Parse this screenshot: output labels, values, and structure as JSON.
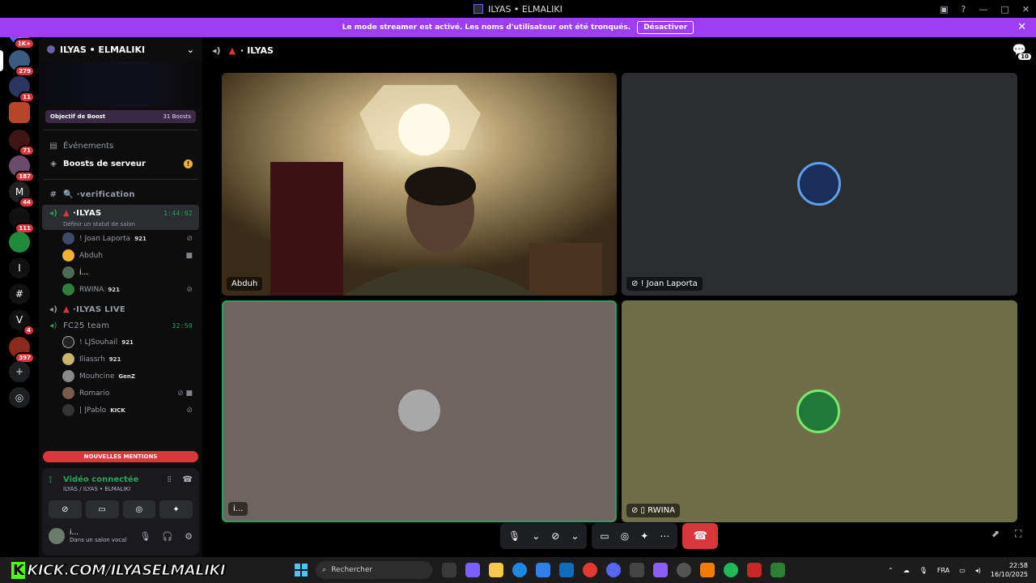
{
  "window": {
    "title": "ILYAS • ELMALIKI"
  },
  "banner": {
    "text": "Le mode streamer est activé. Les noms d'utilisateur ont été tronqués.",
    "button": "Désactiver"
  },
  "guilds": [
    {
      "badge": "1K+"
    },
    {
      "badge": "279"
    },
    {
      "badge": "11"
    },
    {
      "badge": ""
    },
    {
      "badge": "71"
    },
    {
      "badge": "187"
    },
    {
      "badge": "44"
    },
    {
      "badge": "111"
    },
    {
      "badge": ""
    },
    {
      "badge": ""
    },
    {
      "badge": ""
    },
    {
      "badge": "4"
    },
    {
      "badge": "397"
    }
  ],
  "sidebar": {
    "server_name": "ILYAS • ELMALIKI",
    "boost_goal": "Objectif de Boost",
    "boost_count": "31 Boosts",
    "events": "Événements",
    "server_boosts": "Boosts de serveur",
    "channel_verification": "verification",
    "active_channel": {
      "name": "ILYAS",
      "time": "1:44:02",
      "status": "Définir un statut de salon"
    },
    "active_users": [
      {
        "name": "! Joan Laporta",
        "tag": "921"
      },
      {
        "name": "Abduh",
        "tag": ""
      },
      {
        "name": "i...",
        "tag": ""
      },
      {
        "name": "RWINA",
        "tag": "921"
      }
    ],
    "channel_live": "ILYAS LIVE",
    "channel_fc25": {
      "name": "FC25 team",
      "time": "32:50"
    },
    "fc25_users": [
      {
        "name": "! LJSouhail",
        "tag": "921"
      },
      {
        "name": "Iliassrh",
        "tag": "921"
      },
      {
        "name": "Mouhcine",
        "tag": "GenZ"
      },
      {
        "name": "Romario",
        "tag": ""
      },
      {
        "name": "| |Pablo",
        "tag": "KICK"
      }
    ],
    "new_mentions": "NOUVELLES MENTIONS"
  },
  "voice": {
    "status": "Vidéo connectée",
    "location": "ILYAS / ILYAS • ELMALIKI",
    "me_name": "i...",
    "me_status": "Dans un salon vocal"
  },
  "main": {
    "channel": "ILYAS",
    "chat_count": "10",
    "tiles": [
      {
        "label": "Abduh"
      },
      {
        "label": "! Joan Laporta"
      },
      {
        "label": "i..."
      },
      {
        "label": "RWINA"
      }
    ]
  },
  "taskbar": {
    "kick": "KICK.COM/ILYASELMALIKI",
    "search": "Rechercher",
    "lang": "FRA",
    "time": "22:58",
    "date": "16/10/2025"
  }
}
